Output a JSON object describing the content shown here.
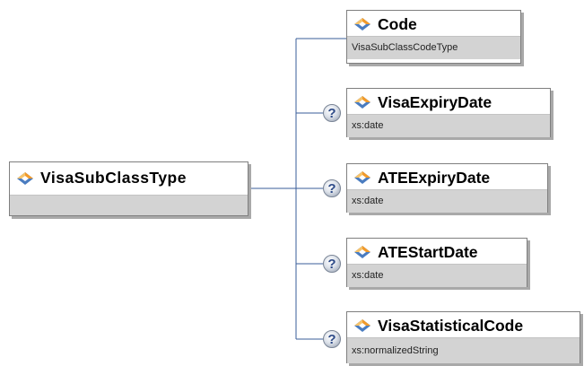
{
  "diagram": {
    "root": {
      "name": "VisaSubClassType",
      "type": ""
    },
    "elements": [
      {
        "name": "Code",
        "type": "VisaSubClassCodeType",
        "optional": false
      },
      {
        "name": "VisaExpiryDate",
        "type": "xs:date",
        "optional": true,
        "optional_mark": "?"
      },
      {
        "name": "ATEExpiryDate",
        "type": "xs:date",
        "optional": true,
        "optional_mark": "?"
      },
      {
        "name": "ATEStartDate",
        "type": "xs:date",
        "optional": true,
        "optional_mark": "?"
      },
      {
        "name": "VisaStatisticalCode",
        "type": "xs:normalizedString",
        "optional": true,
        "optional_mark": "?"
      }
    ],
    "colors": {
      "connector": "#3a5d9a",
      "box_border": "#7f7f7f",
      "type_band": "#d3d3d3",
      "icon_orange": "#f29a2a",
      "icon_blue": "#4a7cc0"
    },
    "icons": {
      "element": "diamond-icon",
      "optional": "question-mark-icon"
    }
  }
}
